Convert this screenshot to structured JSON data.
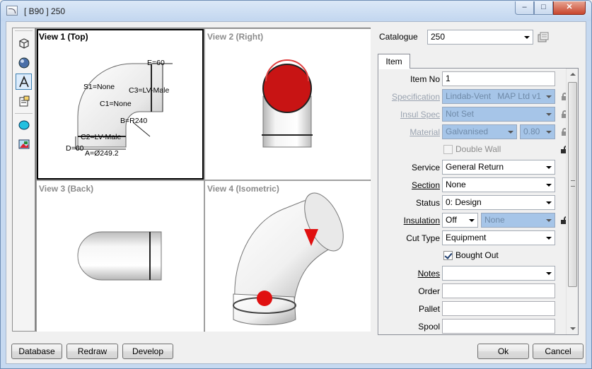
{
  "window": {
    "title": "[ B90 ]  250",
    "min_glyph": "‒",
    "max_glyph": "□",
    "close_glyph": "✕"
  },
  "views": [
    {
      "label": "View 1 (Top)",
      "active": true
    },
    {
      "label": "View 2 (Right)",
      "active": false
    },
    {
      "label": "View 3 (Back)",
      "active": false
    },
    {
      "label": "View 4 (Isometric)",
      "active": false
    }
  ],
  "top_view_annotations": {
    "e": "E=60",
    "s1": "S1=None",
    "c3": "C3=LV-Male",
    "c1": "C1=None",
    "b": "B=R240",
    "c2": "C2=LV-Male",
    "d": "D=60",
    "a": "A=Ø249.2"
  },
  "catalogue": {
    "label": "Catalogue",
    "value": "250"
  },
  "tab": {
    "label": "Item"
  },
  "form": {
    "item_no": {
      "label": "Item No",
      "value": "1"
    },
    "specification": {
      "label": "Specification",
      "value": "Lindab-Vent",
      "value2": "MAP Ltd v1"
    },
    "insul_spec": {
      "label": "Insul Spec",
      "value": "Not Set"
    },
    "material": {
      "label": "Material",
      "value": "Galvanised",
      "gauge": "0.80"
    },
    "double_wall": {
      "label": "Double Wall",
      "checked": false
    },
    "service": {
      "label": "Service",
      "value": "General Return"
    },
    "section": {
      "label": "Section",
      "value": "None"
    },
    "status": {
      "label": "Status",
      "value": "0: Design"
    },
    "insulation": {
      "label": "Insulation",
      "value": "Off",
      "type": "None"
    },
    "cut_type": {
      "label": "Cut Type",
      "value": "Equipment"
    },
    "bought_out": {
      "label": "Bought Out",
      "checked": true
    },
    "notes": {
      "label": "Notes",
      "value": ""
    },
    "order": {
      "label": "Order",
      "value": ""
    },
    "pallet": {
      "label": "Pallet",
      "value": ""
    },
    "spool": {
      "label": "Spool",
      "value": ""
    }
  },
  "buttons": {
    "database": "Database",
    "redraw": "Redraw",
    "develop": "Develop",
    "ok": "Ok",
    "cancel": "Cancel"
  },
  "colors": {
    "connector_red": "#cc1010",
    "disabled_field": "#a6c5e8",
    "view_border_active": "#000000"
  }
}
